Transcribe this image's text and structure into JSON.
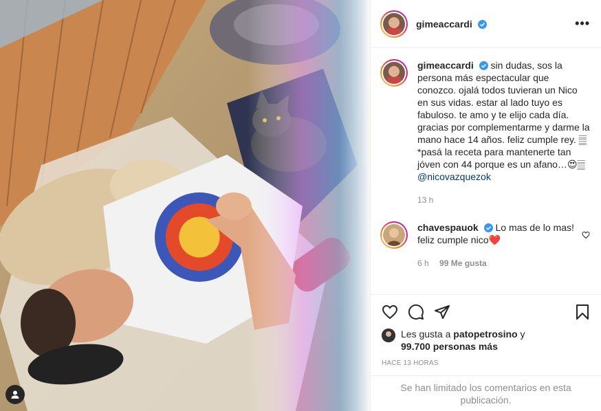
{
  "header": {
    "username": "gimeaccardi",
    "more_label": "•••"
  },
  "caption": {
    "username": "gimeaccardi",
    "text": "sin dudas, sos la persona más espectacular que conozco. ojalá todos tuvieran un Nico en sus vidas. estar al lado tuyo es fabuloso. te amo y te elijo cada día. gracias por complementarme y darme la mano hace 14 años. feliz cumple rey. 𝄛\n*pasá la receta para mantenerte tan jóven con 44 porque es un afano…😍𝄛",
    "mention": "@nicovazquezok",
    "time": "13 h"
  },
  "comment": {
    "username": "chavespauok",
    "text": "Lo mas de lo mas! feliz cumple nico❤️",
    "time": "6 h",
    "likes": "99 Me gusta"
  },
  "likes": {
    "prefix": "Les gusta a",
    "user": "patopetrosino",
    "joiner": "y",
    "count": "99.700 personas más"
  },
  "timestamp": "HACE 13 HORAS",
  "comments_limited": "Se han limitado los comentarios en esta publicación.",
  "icons": [
    "heart-icon",
    "comment-icon",
    "share-icon",
    "bookmark-icon",
    "verified-icon",
    "user-tag-icon"
  ],
  "colors": {
    "verified": "#3897f0",
    "mention": "#00376b",
    "muted": "#8e8e8e"
  }
}
